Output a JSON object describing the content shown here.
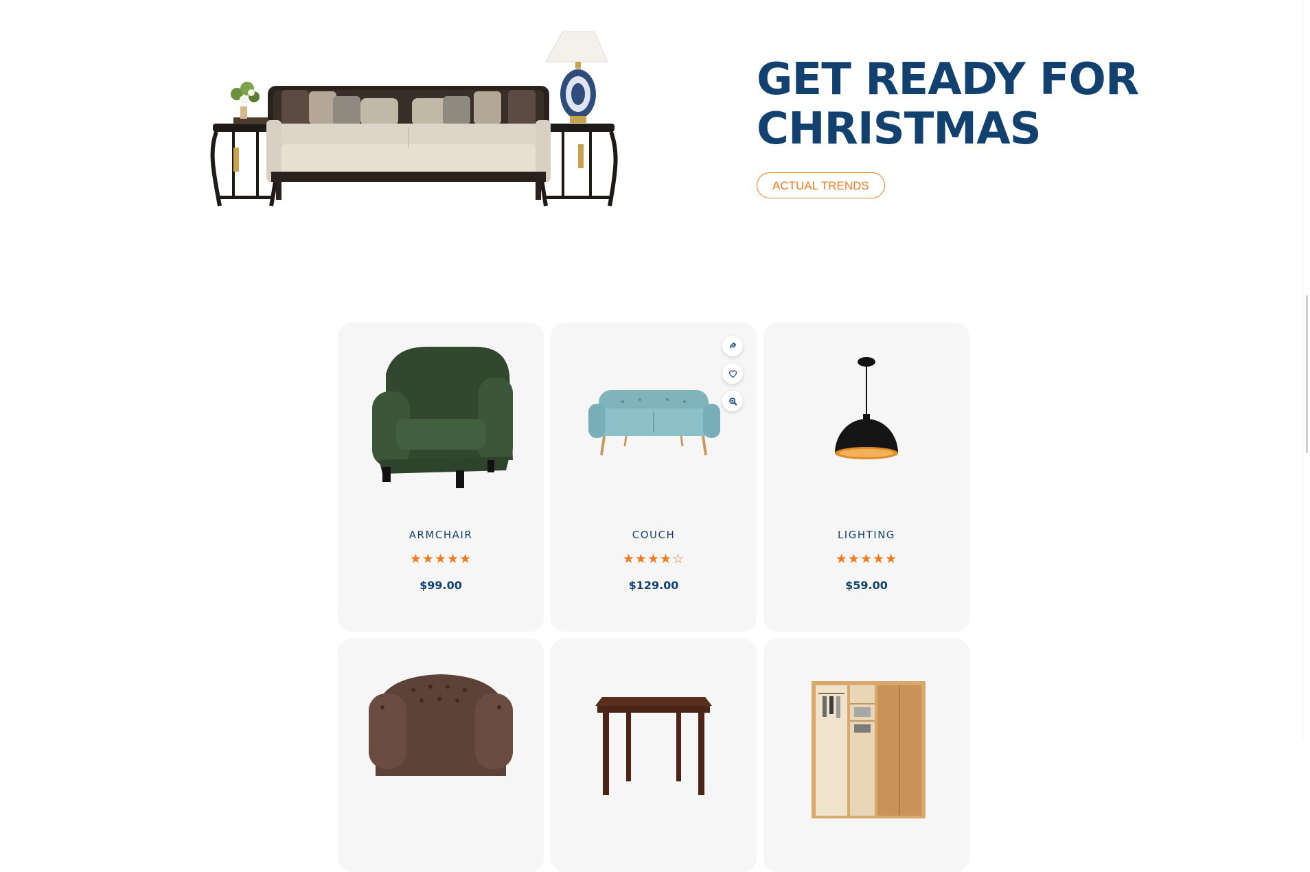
{
  "hero": {
    "title": "GET READY FOR\nCHRISTMAS",
    "button_label": "ACTUAL TRENDS"
  },
  "colors": {
    "primary": "#12416f",
    "accent": "#f07b20",
    "card_bg": "#f6f6f6"
  },
  "products": [
    {
      "name": "ARMCHAIR",
      "price": "$99.00",
      "rating": 5,
      "rating_max": 5
    },
    {
      "name": "COUCH",
      "price": "$129.00",
      "rating": 4,
      "rating_max": 5
    },
    {
      "name": "LIGHTING",
      "price": "$59.00",
      "rating": 5,
      "rating_max": 5
    }
  ],
  "product_actions": [
    {
      "icon": "link-icon"
    },
    {
      "icon": "heart-icon"
    },
    {
      "icon": "zoom-icon"
    }
  ]
}
